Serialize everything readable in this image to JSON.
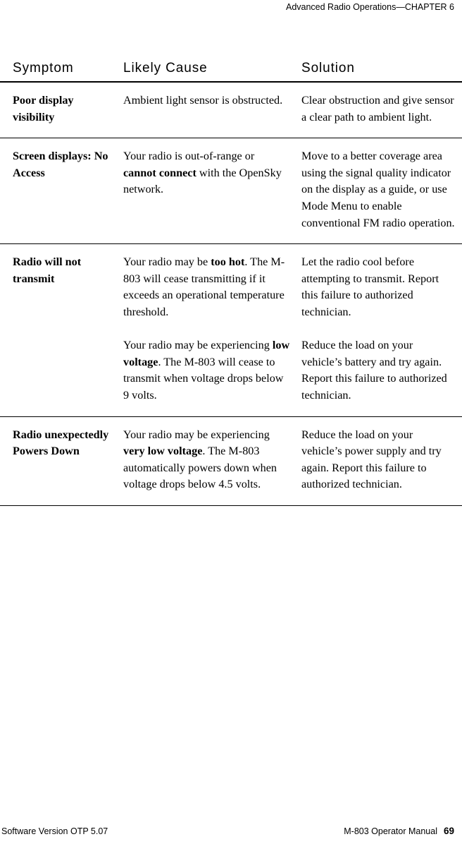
{
  "running_header": "Advanced Radio Operations—CHAPTER 6",
  "table": {
    "headers": {
      "symptom": "Symptom",
      "cause": "Likely Cause",
      "solution": "Solution"
    },
    "rows": [
      {
        "symptom": "Poor display visibility",
        "cause_paragraphs": [
          {
            "segments": [
              {
                "text": "Ambient light sensor is obstructed.",
                "bold": false
              }
            ]
          }
        ],
        "solution_paragraphs": [
          {
            "segments": [
              {
                "text": "Clear obstruction and give sensor a clear path to ambient light.",
                "bold": false
              }
            ]
          }
        ]
      },
      {
        "symptom": "Screen displays: No Access",
        "cause_paragraphs": [
          {
            "segments": [
              {
                "text": "Your radio is out-of-range or ",
                "bold": false
              },
              {
                "text": "cannot connect",
                "bold": true
              },
              {
                "text": " with the OpenSky network.",
                "bold": false
              }
            ]
          }
        ],
        "solution_paragraphs": [
          {
            "segments": [
              {
                "text": "Move to a better coverage area using the signal quality indicator on the display as a guide, or use Mode Menu to enable conventional FM radio operation.",
                "bold": false
              }
            ]
          }
        ]
      },
      {
        "symptom": "Radio will not transmit",
        "cause_paragraphs": [
          {
            "segments": [
              {
                "text": "Your radio may be ",
                "bold": false
              },
              {
                "text": "too hot",
                "bold": true
              },
              {
                "text": ". The M-803 will cease transmitting if it exceeds an operational temperature threshold.",
                "bold": false
              }
            ]
          },
          {
            "segments": [
              {
                "text": "Your radio may be experiencing ",
                "bold": false
              },
              {
                "text": "low voltage",
                "bold": true
              },
              {
                "text": ". The M-803 will cease to transmit when voltage drops below 9 volts.",
                "bold": false
              }
            ]
          }
        ],
        "solution_paragraphs": [
          {
            "segments": [
              {
                "text": "Let the radio cool before attempting to transmit. Report this failure to authorized technician.",
                "bold": false
              }
            ]
          },
          {
            "segments": [
              {
                "text": "Reduce the load on your vehicle’s battery and try again. Report this failure to authorized technician.",
                "bold": false
              }
            ]
          }
        ]
      },
      {
        "symptom": "Radio unexpectedly Powers Down",
        "cause_paragraphs": [
          {
            "segments": [
              {
                "text": "Your radio may be experiencing ",
                "bold": false
              },
              {
                "text": "very low voltage",
                "bold": true
              },
              {
                "text": ". The M-803 automatically powers down when voltage drops below 4.5 volts.",
                "bold": false
              }
            ]
          }
        ],
        "solution_paragraphs": [
          {
            "segments": [
              {
                "text": "Reduce the load on your vehicle’s power supply and try again. Report this failure to authorized technician.",
                "bold": false
              }
            ]
          }
        ]
      }
    ]
  },
  "footer": {
    "left": "Software Version OTP 5.07",
    "manual": "M-803 Operator Manual",
    "page_number": "69"
  }
}
